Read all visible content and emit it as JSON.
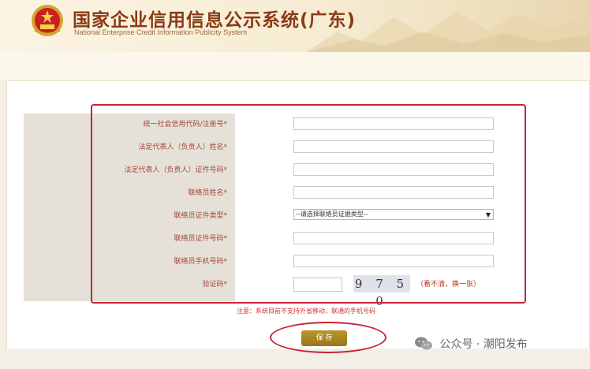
{
  "header": {
    "title": "国家企业信用信息公示系统(广东)",
    "subtitle": "National Enterprise Credit Information Publicity System"
  },
  "form": {
    "fields": [
      {
        "label": "统一社会信用代码/注册号*",
        "type": "text",
        "value": ""
      },
      {
        "label": "法定代表人（负责人）姓名*",
        "type": "text",
        "value": ""
      },
      {
        "label": "法定代表人（负责人）证件号码*",
        "type": "text",
        "value": ""
      },
      {
        "label": "联络员姓名*",
        "type": "text",
        "value": ""
      },
      {
        "label": "联络员证件类型*",
        "type": "select",
        "value": "--请选择联络员证据类型--"
      },
      {
        "label": "联络员证件号码*",
        "type": "text",
        "value": ""
      },
      {
        "label": "联络员手机号码*",
        "type": "text",
        "value": ""
      }
    ],
    "captcha": {
      "label": "验证码*",
      "value": "",
      "image_text": "9 7 5 0",
      "refresh_link": "（看不清，换一张）"
    }
  },
  "notice": "注意：系统目前不支持外省移动，联通的手机号码",
  "save_button": "保 存",
  "watermark": {
    "text": "公众号 · 潮阳发布",
    "icon": "wechat-icon"
  },
  "colors": {
    "label_text": "#a0493c",
    "highlight": "#c82335",
    "button": "#a8851f",
    "title": "#8a3a16"
  }
}
